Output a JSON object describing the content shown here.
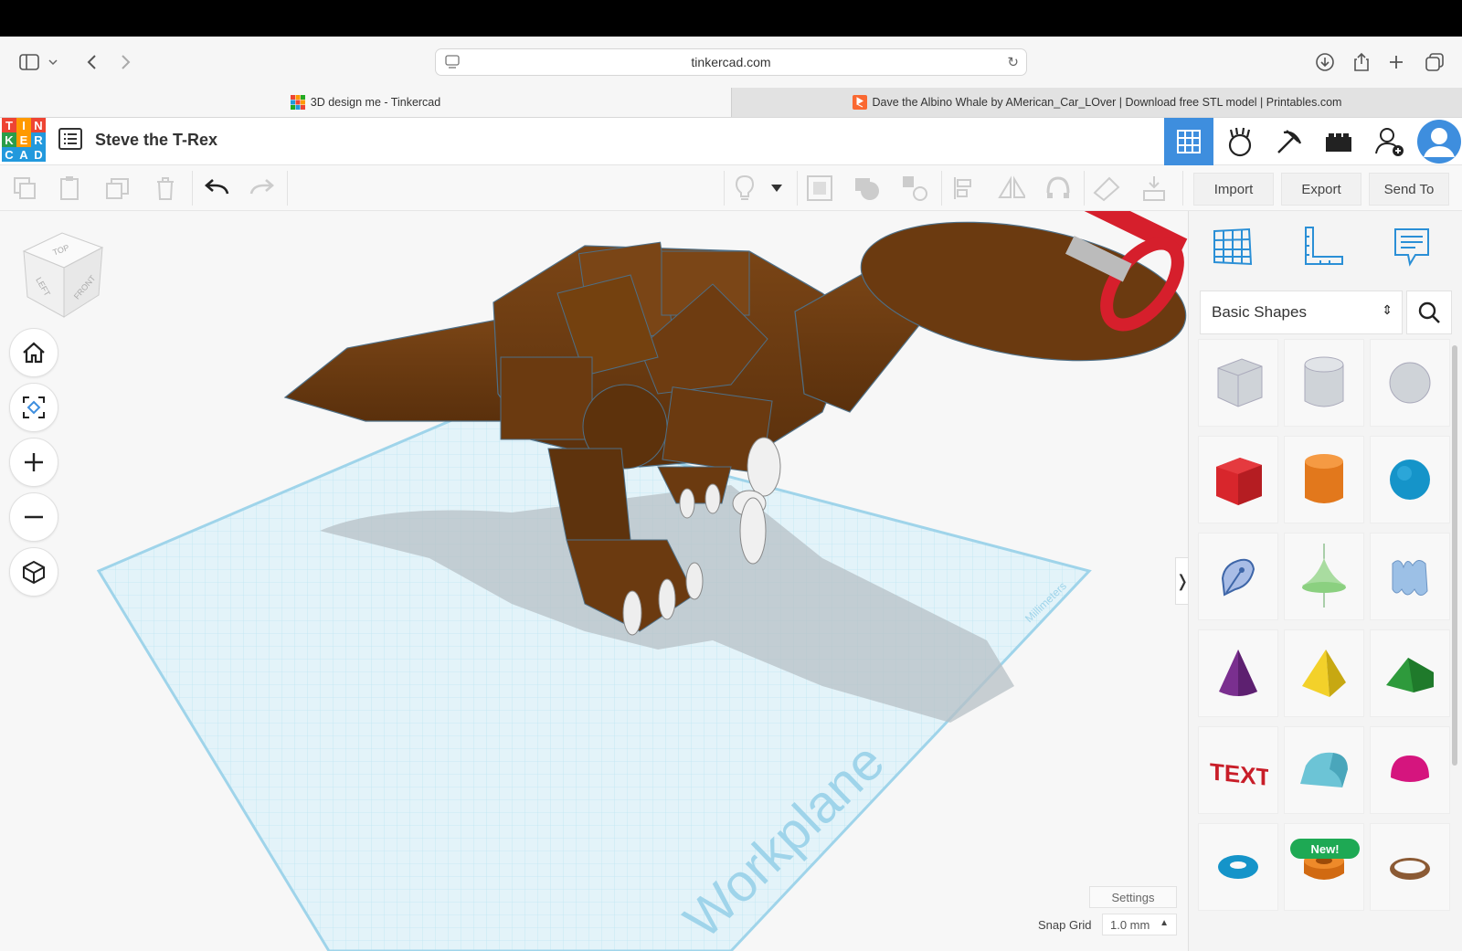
{
  "browser": {
    "url": "tinkercad.com",
    "tabs": [
      {
        "title": "3D design me - Tinkercad",
        "active": true
      },
      {
        "title": "Dave the Albino Whale by AMerican_Car_LOver | Download free STL model | Printables.com",
        "active": false
      }
    ],
    "icons": [
      "sidebar-icon",
      "chevron-down-icon",
      "back-icon",
      "forward-icon",
      "reader-icon",
      "reload-icon",
      "download-icon",
      "share-icon",
      "new-tab-icon",
      "tab-overview-icon"
    ]
  },
  "app": {
    "logo_letters": [
      "T",
      "I",
      "N",
      "K",
      "E",
      "R",
      "C",
      "A",
      "D"
    ],
    "design_name": "Steve the T-Rex",
    "views": [
      "3d-design-view-icon",
      "codeblocks-icon",
      "minecraft-icon",
      "lego-bricks-icon",
      "invite-user-icon",
      "profile-avatar-icon"
    ]
  },
  "toolbar": {
    "tools": [
      "copy-icon",
      "paste-icon",
      "duplicate-icon",
      "delete-icon",
      "undo-icon",
      "redo-icon",
      "notes-light-icon",
      "dropdown-icon",
      "group-icon",
      "union-icon",
      "ungroup-icon",
      "align-icon",
      "mirror-icon",
      "cruise-icon",
      "workplane-icon",
      "ruler-drop-icon"
    ],
    "import_label": "Import",
    "export_label": "Export",
    "sendto_label": "Send To"
  },
  "viewcube": {
    "top": "TOP",
    "left": "LEFT",
    "front": "FRONT"
  },
  "workplane": {
    "label": "Workplane",
    "units": "Millimeters"
  },
  "bottom": {
    "settings_label": "Settings",
    "snap_label": "Snap Grid",
    "snap_value": "1.0 mm"
  },
  "panel": {
    "category": "Basic Shapes",
    "new_badge": "New!",
    "shapes": [
      "Box (hole)",
      "Cylinder (hole)",
      "Sphere (hole)",
      "Box",
      "Cylinder",
      "Sphere",
      "Scribble",
      "Paraboloid",
      "Shape generator",
      "Cone",
      "Pyramid",
      "Roof",
      "Text",
      "Half cylinder",
      "Half sphere",
      "Torus",
      "Tube",
      "Ring"
    ]
  },
  "colors": {
    "accent": "#3e8ede",
    "model": "#6b3a10",
    "workplane": "#dff1f8",
    "grid_line": "#a8dcef"
  }
}
